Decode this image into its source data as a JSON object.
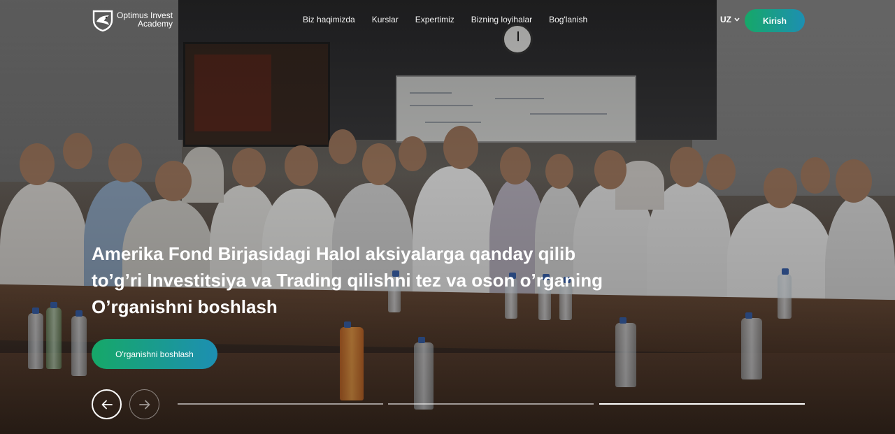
{
  "brand": {
    "line1": "Optimus Invest",
    "line2": "Academy",
    "logo_icon": "eagle-shield-icon"
  },
  "nav": {
    "items": [
      {
        "label": "Biz haqimizda"
      },
      {
        "label": "Kurslar"
      },
      {
        "label": "Expertimiz"
      },
      {
        "label": "Bizning loyihalar"
      },
      {
        "label": "Bog'lanish"
      }
    ]
  },
  "header": {
    "language": "UZ",
    "language_icon": "chevron-down-icon",
    "login_label": "Kirish"
  },
  "hero": {
    "title_line1": "Amerika Fond Birjasidagi Halol aksiyalarga qanday qilib",
    "title_line2": "to’g’ri Investitsiya va Trading qilishni tez va oson o’rganing",
    "title_line3": "O’rganishni boshlash",
    "cta_label": "O'rganishni boshlash"
  },
  "slider": {
    "prev_icon": "arrow-left-icon",
    "next_icon": "arrow-right-icon",
    "slide_count": 3,
    "active_slide": 3
  },
  "colors": {
    "accent_start": "#16a868",
    "accent_end": "#1d8fb2",
    "text": "#ffffff"
  }
}
